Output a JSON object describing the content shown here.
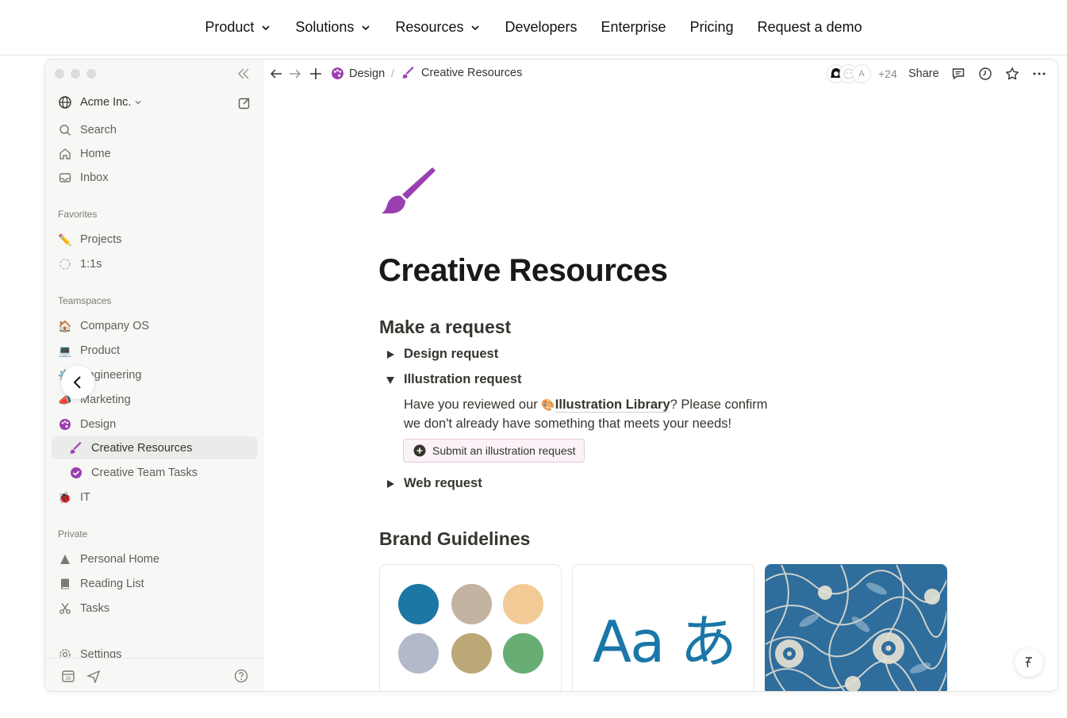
{
  "topnav": {
    "items": [
      {
        "label": "Product",
        "has_dropdown": true
      },
      {
        "label": "Solutions",
        "has_dropdown": true
      },
      {
        "label": "Resources",
        "has_dropdown": true
      },
      {
        "label": "Developers",
        "has_dropdown": false
      },
      {
        "label": "Enterprise",
        "has_dropdown": false
      },
      {
        "label": "Pricing",
        "has_dropdown": false
      },
      {
        "label": "Request a demo",
        "has_dropdown": false
      }
    ]
  },
  "sidebar": {
    "workspace": "Acme Inc.",
    "nav": {
      "search": "Search",
      "home": "Home",
      "inbox": "Inbox"
    },
    "favorites_label": "Favorites",
    "favorites": [
      {
        "label": "Projects",
        "icon": "pencil-icon"
      },
      {
        "label": "1:1s",
        "icon": "speech-bubble-icon"
      }
    ],
    "teamspaces_label": "Teamspaces",
    "teamspaces": [
      {
        "label": "Company OS",
        "icon": "house-icon"
      },
      {
        "label": "Product",
        "icon": "laptop-icon"
      },
      {
        "label": "Engineering",
        "icon": "gear-icon"
      },
      {
        "label": "Marketing",
        "icon": "megaphone-icon"
      },
      {
        "label": "Design",
        "icon": "palette-icon"
      }
    ],
    "sub_pages": [
      {
        "label": "Creative Resources",
        "icon": "paintbrush-icon",
        "active": true
      },
      {
        "label": "Creative Team Tasks",
        "icon": "check-circle-icon",
        "active": false
      }
    ],
    "it": {
      "label": "IT",
      "icon": "bug-icon"
    },
    "private_label": "Private",
    "private": [
      {
        "label": "Personal Home",
        "icon": "shapes-icon"
      },
      {
        "label": "Reading List",
        "icon": "book-icon"
      },
      {
        "label": "Tasks",
        "icon": "scissors-icon"
      }
    ],
    "settings": "Settings"
  },
  "topbar": {
    "breadcrumb_parent": "Design",
    "breadcrumb_current": "Creative Resources",
    "avatar_letter": "A",
    "extra_count": "+24",
    "share_label": "Share"
  },
  "page": {
    "title": "Creative Resources",
    "section1": "Make a request",
    "toggles": {
      "design": "Design request",
      "illustration": "Illustration request",
      "web": "Web request"
    },
    "para_pre": "Have you reviewed our",
    "para_link": "Illustration Library",
    "para_mid": "? Please confirm",
    "para_line2": "we don't already have something that meets your needs!",
    "submit_button": "Submit an illustration request",
    "section2": "Brand Guidelines",
    "typography_sample": "Aa あ",
    "palette": [
      "#1b77a3",
      "#c2b4a0",
      "#f2ca95",
      "#b3b8cb",
      "#bca877",
      "#67ad74"
    ]
  }
}
